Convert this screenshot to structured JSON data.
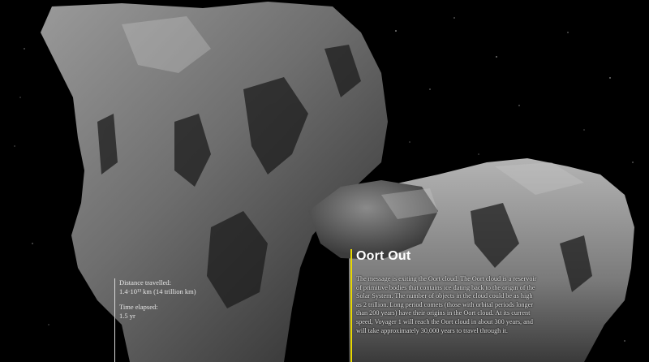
{
  "journey": {
    "distance_label": "Distance travelled:",
    "distance_value": "1.4·10¹³ km (14 trillion km)",
    "time_label": "Time elapsed:",
    "time_value": "1.5 yr"
  },
  "story": {
    "title": "Oort Out",
    "body": "The message is exiting the Oort cloud. The Oort cloud is a reservoir of primitive bodies that contains ice dating back to the origin of the Solar System. The number of objects in the cloud could be as high as 2 trillion. Long period comets (those with orbital periods longer than 200 years) have their origins in the Oort cloud. At its current speed, Voyager 1 will reach the Oort cloud in about 300 years, and will take approximately 30,000 years to travel through it."
  },
  "colors": {
    "accent_bar": "#e8d800",
    "background": "#000000"
  }
}
